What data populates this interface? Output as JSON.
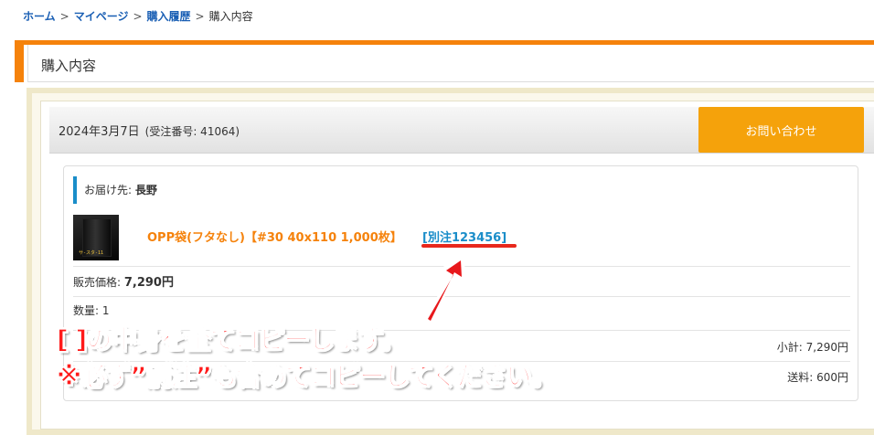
{
  "breadcrumb": {
    "home": "ホーム",
    "mypage": "マイページ",
    "history": "購入履歴",
    "current": "購入内容",
    "separator": ">"
  },
  "page": {
    "title": "購入内容"
  },
  "order": {
    "date": "2024年3月7日",
    "number_text": "(受注番号: 41064)",
    "contact_button": "お問い合わせ"
  },
  "shipping": {
    "label": "お届け先: ",
    "name": "長野"
  },
  "product": {
    "thumb_text": "サ-スタ-11",
    "name": "OPP袋(フタなし)【#30 40x110 1,000枚】",
    "code": "[別注123456]"
  },
  "rows": {
    "price_label": "販売価格: ",
    "price_value": "7,290円",
    "quantity_text": "数量: 1",
    "subtotal_text": "小計: 7,290円",
    "shipping_fee_text": "送料: 600円"
  },
  "annotation": {
    "line1": "[ ]の中身を全てコピーします。",
    "line2": "※必ず”別注”も含めてコピーしてください。"
  },
  "colors": {
    "accent_orange": "#f5820b",
    "button_orange": "#f5a20b",
    "link_blue": "#1a5fb4",
    "code_blue": "#1a8dc9",
    "annotation_red": "#ff1a1a"
  }
}
